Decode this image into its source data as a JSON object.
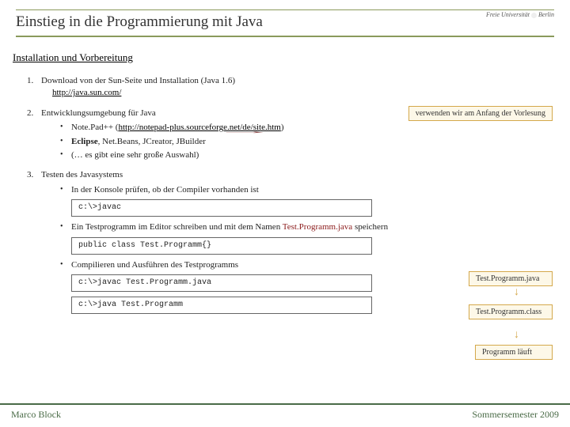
{
  "header": {
    "title": "Einstieg in die Programmierung mit Java",
    "uni": "Freie Universität",
    "uni_city": "Berlin"
  },
  "subtitle": "Installation und Vorbereitung",
  "items": [
    {
      "num": "1.",
      "text": "Download von der Sun-Seite und Installation (Java 1.6)",
      "link": "http://java.sun.com/"
    },
    {
      "num": "2.",
      "text": "Entwicklungsumgebung für Java",
      "bullets": [
        {
          "pre": "Note.Pad++ (",
          "link": "http://notepad-plus.sourceforge.net/de/site.htm",
          "post": ")"
        },
        {
          "bold": "Eclipse",
          "rest": ", Net.Beans, JCreator, JBuilder"
        },
        {
          "plain": "(… es gibt eine sehr große Auswahl)"
        }
      ]
    },
    {
      "num": "3.",
      "text": "Testen des Javasystems",
      "sub": [
        {
          "text": "In der Konsole prüfen, ob der Compiler vorhanden ist",
          "code": "c:\\>javac"
        },
        {
          "text_pre": "Ein Testprogramm im Editor schreiben und mit dem Namen ",
          "red": "Test.Programm.java",
          "text_post": " speichern",
          "code": "public class Test.Programm{}"
        },
        {
          "text": "Compilieren und Ausführen des Testprogramms",
          "code": "c:\\>javac  Test.Programm.java",
          "code2": "c:\\>java Test.Programm"
        }
      ]
    }
  ],
  "notes": {
    "top": "verwenden wir am Anfang der Vorlesung",
    "r1": "Test.Programm.java",
    "r2": "Test.Programm.class",
    "r3": "Programm läuft"
  },
  "footer": {
    "left": "Marco Block",
    "right": "Sommersemester 2009"
  }
}
